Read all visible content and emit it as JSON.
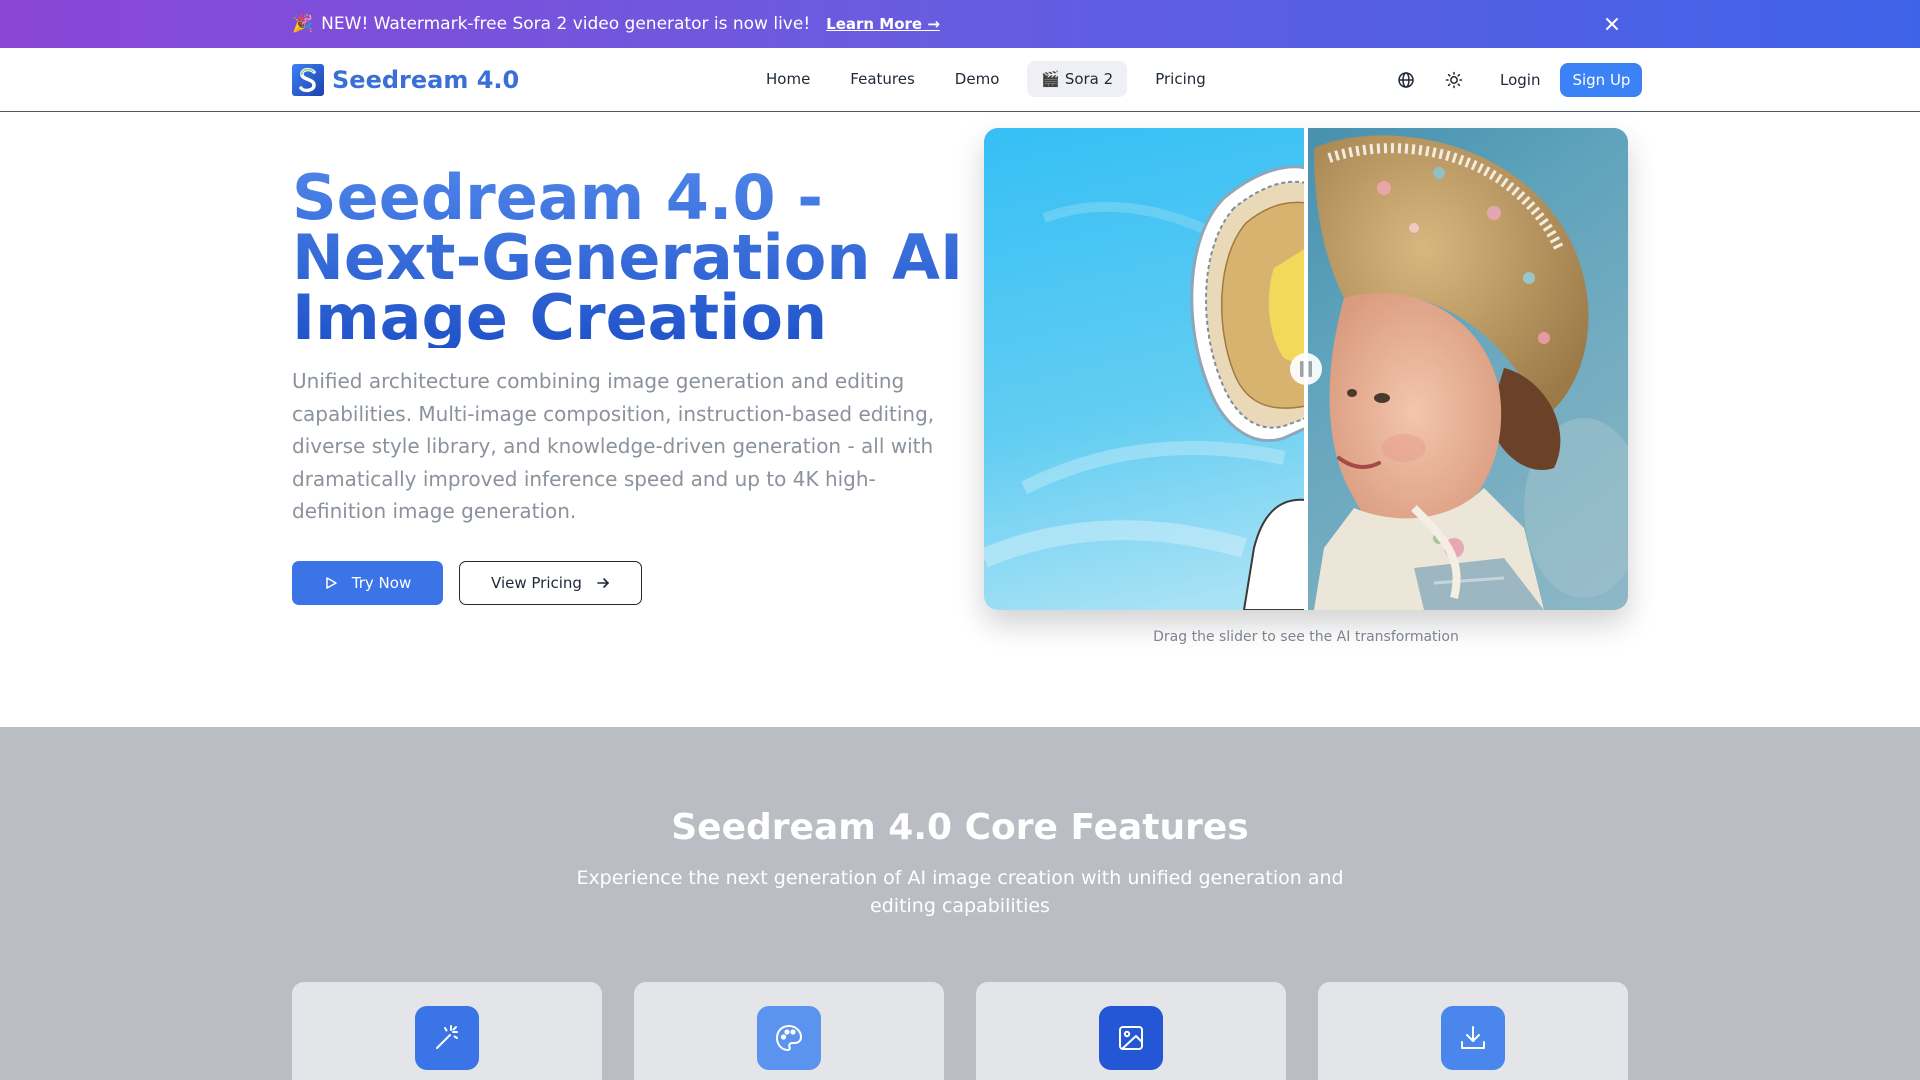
{
  "announcement": {
    "emoji": "🎉",
    "text": "NEW! Watermark-free Sora 2 video generator is now live!",
    "link": "Learn More →"
  },
  "nav": {
    "brand": "Seedream 4.0",
    "links": [
      "Home",
      "Features",
      "Demo",
      "🎬 Sora 2",
      "Pricing"
    ],
    "active_link": "🎬 Sora 2",
    "login": "Login",
    "signup": "Sign Up",
    "icons": [
      "globe-icon",
      "sun-icon"
    ]
  },
  "hero": {
    "title": "Seedream 4.0 - Next-Generation AI Image Creation",
    "description": "Unified architecture combining image generation and editing capabilities. Multi-image composition, instruction-based editing, diverse style library, and knowledge-driven generation - all with dramatically improved inference speed and up to 4K high-definition image generation.",
    "try_now": "Try Now",
    "view_pricing": "View Pricing",
    "compare_caption": "Drag the slider to see the AI transformation",
    "slider_position": 0.5
  },
  "features": {
    "title": "Seedream 4.0 Core Features",
    "subtitle": "Experience the next generation of AI image creation with unified generation and editing capabilities",
    "cards": [
      {
        "icon": "magic-wand-icon",
        "color": "#3b74e6"
      },
      {
        "icon": "palette-icon",
        "color": "#5b94ef"
      },
      {
        "icon": "image-icon",
        "color": "#2357d6"
      },
      {
        "icon": "download-icon",
        "color": "#4a86ec"
      }
    ]
  },
  "colors": {
    "brand": "#3b6fd8",
    "primary_button": "#3b74e6",
    "banner_start": "#8b46d6",
    "banner_end": "#3f63e8"
  }
}
